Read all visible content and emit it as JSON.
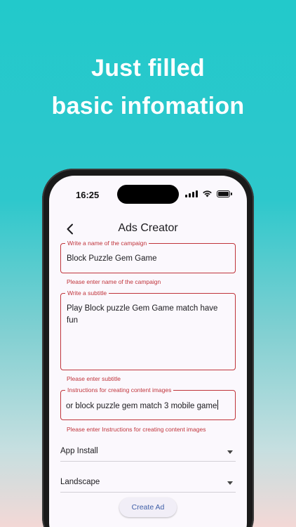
{
  "headline": {
    "line1": "Just filled",
    "line2": "basic infomation"
  },
  "status_bar": {
    "time": "16:25"
  },
  "app_bar": {
    "title": "Ads Creator"
  },
  "form": {
    "campaign_name": {
      "label": "Write a name of the campaign",
      "value": "Block Puzzle Gem Game",
      "error": "Please enter name of the campaign"
    },
    "subtitle": {
      "label": "Write a subtitle",
      "value": "Play Block puzzle Gem Game match have fun",
      "error": "Please enter subtitle"
    },
    "instructions": {
      "label": "Instructions for creating content images",
      "value": "or block puzzle gem match 3 mobile game",
      "error": "Please enter Instructions for creating content images"
    },
    "ad_type": {
      "selected": "App Install"
    },
    "orientation": {
      "selected": "Landscape"
    },
    "submit_label": "Create Ad"
  },
  "colors": {
    "background_top": "#22c9cb",
    "error": "#c0343b",
    "button_text": "#3f5fa8"
  }
}
